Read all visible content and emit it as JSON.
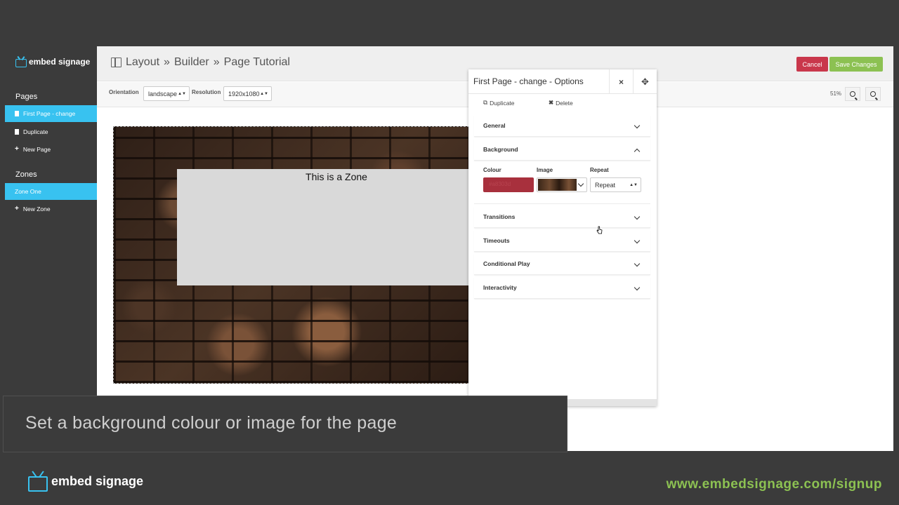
{
  "sidebar": {
    "logo": "embed signage",
    "pages_title": "Pages",
    "pages": [
      {
        "label": "First Page - change",
        "icon": "document-icon",
        "active": true
      },
      {
        "label": "Duplicate",
        "icon": "document-icon",
        "active": false
      },
      {
        "label": "New Page",
        "icon": "plus-icon",
        "active": false
      }
    ],
    "zones_title": "Zones",
    "zones": [
      {
        "label": "Zone One",
        "active": true
      },
      {
        "label": "New Zone",
        "icon": "plus-icon",
        "active": false
      }
    ]
  },
  "header": {
    "breadcrumb": [
      "Layout",
      "Builder",
      "Page Tutorial"
    ],
    "separator": "»",
    "cancel_label": "Cancel",
    "save_label": "Save Changes"
  },
  "toolbar": {
    "orientation_label": "Orientation",
    "orientation_value": "landscape",
    "resolution_label": "Resolution",
    "resolution_value": "1920x1080",
    "zoom": "51%"
  },
  "canvas": {
    "zone_text": "This is a Zone"
  },
  "options": {
    "title": "First Page - change - Options",
    "close": "×",
    "move": "✥",
    "duplicate_label": "Duplicate",
    "delete_label": "Delete",
    "sections": {
      "general": "General",
      "background": "Background",
      "transitions": "Transitions",
      "timeouts": "Timeouts",
      "conditional_play": "Conditional Play",
      "interactivity": "Interactivity"
    },
    "background": {
      "colour_label": "Colour",
      "colour_value": "#a8303d",
      "image_label": "Image",
      "repeat_label": "Repeat",
      "repeat_value": "Repeat"
    }
  },
  "caption": "Set a background colour or image for the page",
  "footer": {
    "logo": "embed signage",
    "signup": "www.embedsignage.com/signup"
  },
  "colors": {
    "accent": "#38c2f0",
    "cancel": "#c9374b",
    "save": "#8cc152",
    "background": "#3b3b3b"
  }
}
